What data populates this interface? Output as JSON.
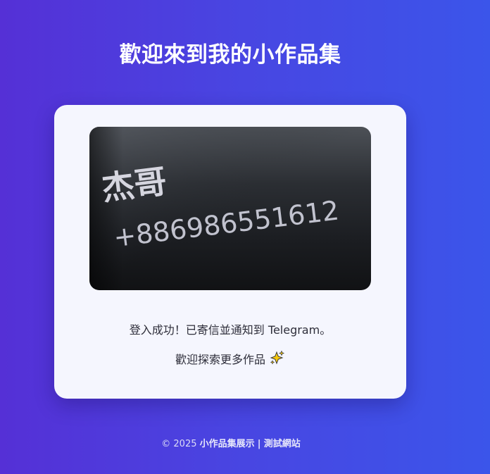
{
  "header": {
    "title": "歡迎來到我的小作品集"
  },
  "card": {
    "photo": {
      "name_text": "杰哥",
      "phone_text": "+886986551612"
    },
    "message_line_1": "登入成功！已寄信並通知到 Telegram。",
    "message_line_2": "歡迎探索更多作品",
    "message_icon": "sparkles-icon"
  },
  "footer": {
    "copyright": "© 2025",
    "site_name": "小作品集展示",
    "separator": "|",
    "site_tag": "測試網站"
  },
  "colors": {
    "background_start": "#5530d6",
    "background_end": "#3b55ea",
    "card_background": "#f5f6fe",
    "title_text": "#ffffff"
  }
}
